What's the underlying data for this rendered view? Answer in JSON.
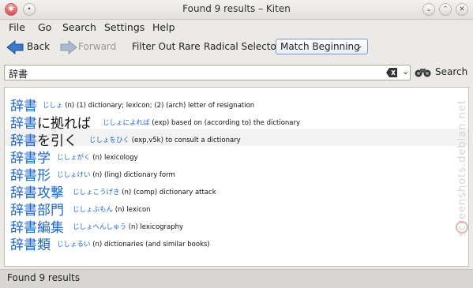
{
  "window": {
    "title": "Found 9 results – Kiten"
  },
  "menu": [
    "File",
    "Go",
    "Search",
    "Settings",
    "Help"
  ],
  "toolbar": {
    "back": "Back",
    "forward": "Forward",
    "filter_rare": "Filter Out Rare",
    "radical_selector": "Radical Selector",
    "match_mode": "Match Beginning"
  },
  "search": {
    "query": "辞書",
    "button": "Search"
  },
  "results": [
    {
      "k": "辞書",
      "h": "",
      "reading": "じしょ",
      "def": "(n) (1) dictionary; lexicon; (2) (arch) letter of resignation"
    },
    {
      "k": "辞書",
      "h": "に拠れば",
      "reading": "じしょによれば",
      "def": "(exp) based on (according to) the dictionary"
    },
    {
      "k": "辞書",
      "h": "を引く",
      "reading": "じしょをひく",
      "def": "(exp,v5k) to consult a dictionary"
    },
    {
      "k": "辞書学",
      "h": "",
      "reading": "じしょがく",
      "def": "(n) lexicology"
    },
    {
      "k": "辞書形",
      "h": "",
      "reading": "じしょけい",
      "def": "(n) (ling) dictionary form"
    },
    {
      "k": "辞書攻撃",
      "h": "",
      "reading": "じしょこうげき",
      "def": "(n) (comp) dictionary attack"
    },
    {
      "k": "辞書部門",
      "h": "",
      "reading": "じしょぶもん",
      "def": "(n) lexicon"
    },
    {
      "k": "辞書編集",
      "h": "",
      "reading": "じしょへんしゅう",
      "def": "(n) lexicography"
    },
    {
      "k": "辞書類",
      "h": "",
      "reading": "じしょるい",
      "def": "(n) dictionaries (and similar books)"
    }
  ],
  "status": "Found 9 results",
  "watermark": "screenshots.debian.net"
}
